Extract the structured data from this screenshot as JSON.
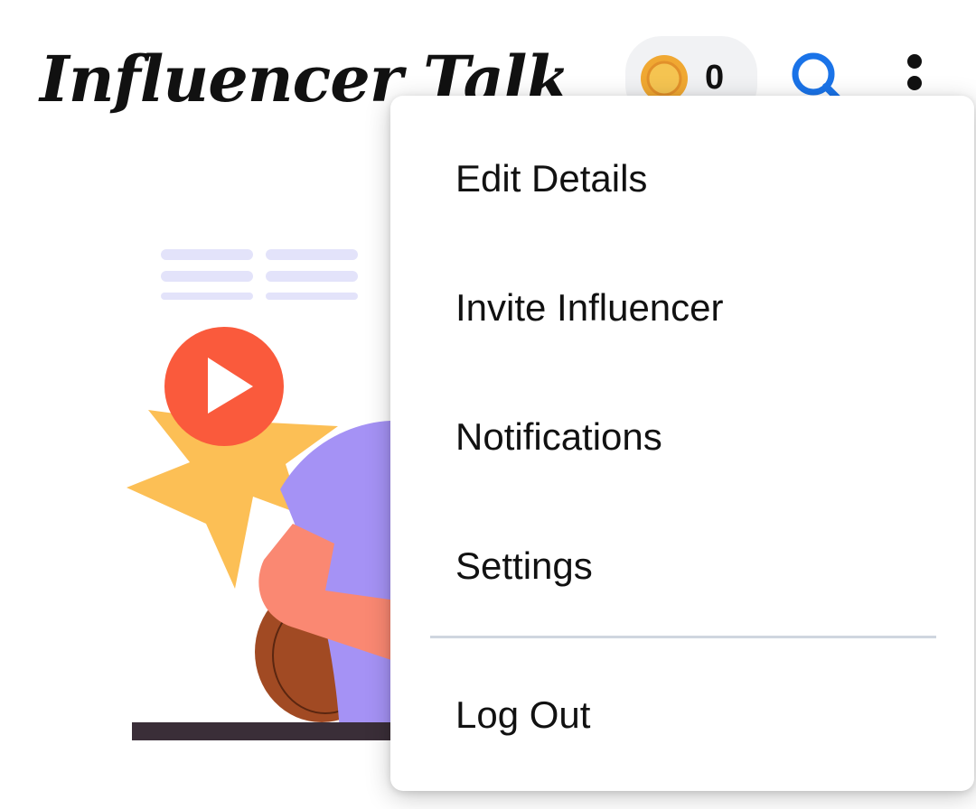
{
  "app": {
    "title": "Influencer Talk"
  },
  "header": {
    "coin_count": "0",
    "icons": {
      "coin": "coin-icon",
      "search": "search-icon",
      "more": "more-vertical-icon"
    }
  },
  "menu": {
    "items": [
      {
        "label": "Edit Details"
      },
      {
        "label": "Invite Influencer"
      },
      {
        "label": "Notifications"
      },
      {
        "label": "Settings"
      },
      {
        "label": "Log Out"
      }
    ]
  },
  "colors": {
    "coin_outer": "#f0a832",
    "coin_inner": "#f5c451",
    "search_blue": "#1a73e8",
    "play_red": "#fa5a3c",
    "star_yellow": "#fcbf55",
    "shirt_purple": "#a592f5",
    "arm_salmon": "#fa8872",
    "ball_brown": "#a14a23",
    "floor_dark": "#3a2e38",
    "doc_lines": "#e3e3fa",
    "divider": "#cfd6df"
  }
}
